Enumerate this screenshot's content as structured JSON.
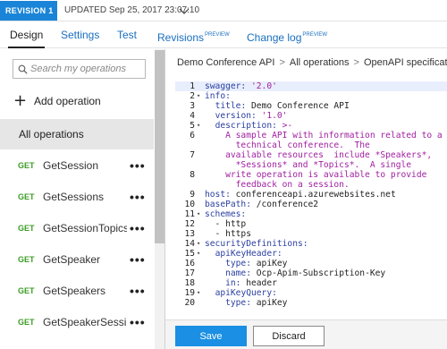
{
  "revision_bar": {
    "badge": "REVISION 1",
    "updated": "UPDATED Sep 25, 2017 23:07:10"
  },
  "tabs": [
    {
      "label": "Design",
      "sup": ""
    },
    {
      "label": "Settings",
      "sup": ""
    },
    {
      "label": "Test",
      "sup": ""
    },
    {
      "label": "Revisions",
      "sup": "PREVIEW"
    },
    {
      "label": "Change log",
      "sup": "PREVIEW"
    }
  ],
  "sidebar": {
    "search_placeholder": "Search my operations",
    "add_operation": "Add operation",
    "all_operations": "All operations",
    "operations": [
      {
        "method": "GET",
        "name": "GetSession"
      },
      {
        "method": "GET",
        "name": "GetSessions"
      },
      {
        "method": "GET",
        "name": "GetSessionTopics"
      },
      {
        "method": "GET",
        "name": "GetSpeaker"
      },
      {
        "method": "GET",
        "name": "GetSpeakers"
      },
      {
        "method": "GET",
        "name": "GetSpeakerSessi..."
      }
    ],
    "more_glyph": "•••"
  },
  "breadcrumb": [
    "Demo Conference API",
    "All operations",
    "OpenAPI specification"
  ],
  "breadcrumb_sep": ">",
  "editor": {
    "lines": [
      {
        "n": "1",
        "fold": "",
        "key": "swagger",
        "text": "swagger: '2.0'"
      },
      {
        "n": "2",
        "fold": "▾",
        "text": "info:"
      },
      {
        "n": "3",
        "fold": "",
        "text": "  title: Demo Conference API"
      },
      {
        "n": "4",
        "fold": "",
        "text": "  version: '1.0'"
      },
      {
        "n": "5",
        "fold": "▾",
        "text": "  description: >-"
      },
      {
        "n": "6",
        "fold": "",
        "text": "    A sample API with information related to a"
      },
      {
        "n": "",
        "fold": "",
        "text": "      technical conference.  The"
      },
      {
        "n": "7",
        "fold": "",
        "text": "    available resources  include *Speakers*,"
      },
      {
        "n": "",
        "fold": "",
        "text": "      *Sessions* and *Topics*.  A single"
      },
      {
        "n": "8",
        "fold": "",
        "text": "    write operation is available to provide"
      },
      {
        "n": "",
        "fold": "",
        "text": "      feedback on a session."
      },
      {
        "n": "9",
        "fold": "",
        "text": "host: conferenceapi.azurewebsites.net"
      },
      {
        "n": "10",
        "fold": "",
        "text": "basePath: /conference2"
      },
      {
        "n": "11",
        "fold": "▾",
        "text": "schemes:"
      },
      {
        "n": "12",
        "fold": "",
        "text": "  - http"
      },
      {
        "n": "13",
        "fold": "",
        "text": "  - https"
      },
      {
        "n": "14",
        "fold": "▾",
        "text": "securityDefinitions:"
      },
      {
        "n": "15",
        "fold": "▾",
        "text": "  apiKeyHeader:"
      },
      {
        "n": "16",
        "fold": "",
        "text": "    type: apiKey"
      },
      {
        "n": "17",
        "fold": "",
        "text": "    name: Ocp-Apim-Subscription-Key"
      },
      {
        "n": "18",
        "fold": "",
        "text": "    in: header"
      },
      {
        "n": "19",
        "fold": "▾",
        "text": "  apiKeyQuery:"
      },
      {
        "n": "20",
        "fold": "",
        "text": "    type: apiKey"
      }
    ]
  },
  "footer": {
    "save": "Save",
    "discard": "Discard"
  },
  "colors": {
    "accent": "#1a8fe3",
    "badge": "#1a85d8",
    "get_method": "#3c9d26",
    "yaml_key": "#2a3fa0",
    "yaml_string": "#a01fa0"
  }
}
